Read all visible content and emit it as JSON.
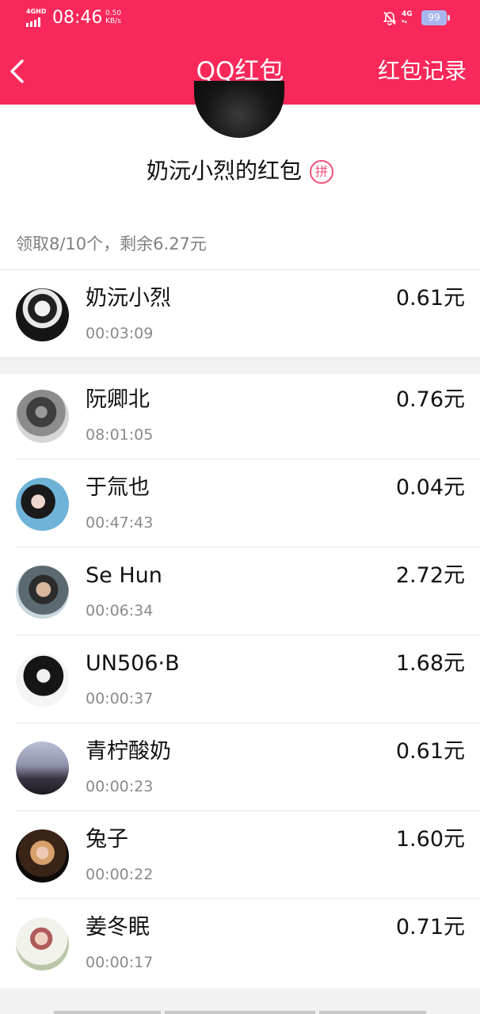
{
  "status_bar": {
    "network_label": "4GHD",
    "time": "08:46",
    "speed_value": "0.50",
    "speed_unit": "KB/s",
    "net_type": "4G",
    "battery": "99"
  },
  "nav": {
    "title": "QQ红包",
    "right_action": "红包记录"
  },
  "sender": {
    "name": "奶沅小烈的红包",
    "badge": "拼"
  },
  "summary": "领取8/10个，剩余6.27元",
  "colors": {
    "header_bg": "#f8285a",
    "badge": "#f0507a"
  },
  "claims": [
    {
      "name": "奶沅小烈",
      "time": "00:03:09",
      "amount": "0.61元"
    },
    {
      "name": "阮卿北",
      "time": "08:01:05",
      "amount": "0.76元"
    },
    {
      "name": "于氚也",
      "time": "00:47:43",
      "amount": "0.04元"
    },
    {
      "name": "Se Hun",
      "time": "00:06:34",
      "amount": "2.72元"
    },
    {
      "name": "UN506·B",
      "time": "00:00:37",
      "amount": "1.68元"
    },
    {
      "name": "青柠酸奶",
      "time": "00:00:23",
      "amount": "0.61元"
    },
    {
      "name": "兔子",
      "time": "00:00:22",
      "amount": "1.60元"
    },
    {
      "name": "姜冬眠",
      "time": "00:00:17",
      "amount": "0.71元"
    }
  ]
}
